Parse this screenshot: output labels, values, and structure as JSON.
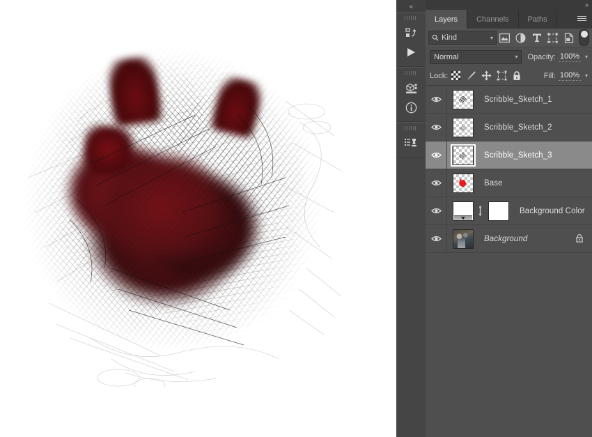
{
  "canvas": {
    "name": "artwork-canvas",
    "description": "Dark red scribbled creature silhouette with black pencil hatching on white background",
    "background_color": "#ffffff",
    "blob_color": "#520a0e",
    "scribble_color": "#1a1a1a"
  },
  "icon_rail": {
    "collapse_label": "«",
    "groups": [
      {
        "icons": [
          {
            "name": "history-icon",
            "glyph": "history"
          },
          {
            "name": "play-icon",
            "glyph": "play"
          }
        ]
      },
      {
        "icons": [
          {
            "name": "properties-3d-icon",
            "glyph": "cube"
          },
          {
            "name": "info-icon",
            "glyph": "info"
          }
        ]
      },
      {
        "icons": [
          {
            "name": "libraries-icon",
            "glyph": "stamp"
          }
        ]
      }
    ]
  },
  "panel": {
    "expand_label": "»",
    "menu_icon": "hamburger-icon",
    "tabs": [
      {
        "label": "Layers",
        "active": true
      },
      {
        "label": "Channels",
        "active": false
      },
      {
        "label": "Paths",
        "active": false
      }
    ],
    "filter": {
      "kind_label": "Kind",
      "search_icon": "search-icon",
      "icons": [
        {
          "name": "filter-pixel-icon",
          "glyph": "image"
        },
        {
          "name": "filter-adjustment-icon",
          "glyph": "half-circle"
        },
        {
          "name": "filter-type-icon",
          "glyph": "T"
        },
        {
          "name": "filter-shape-icon",
          "glyph": "shape"
        },
        {
          "name": "filter-smart-object-icon",
          "glyph": "smart"
        }
      ],
      "toggle_on": true
    },
    "blend_mode": "Normal",
    "opacity_label": "Opacity:",
    "opacity_value": "100%",
    "lock_label": "Lock:",
    "lock_icons": [
      {
        "name": "lock-transparency-icon",
        "glyph": "checker"
      },
      {
        "name": "lock-image-pixels-icon",
        "glyph": "brush"
      },
      {
        "name": "lock-position-icon",
        "glyph": "move"
      },
      {
        "name": "lock-artboard-icon",
        "glyph": "artboard"
      },
      {
        "name": "lock-all-icon",
        "glyph": "padlock"
      }
    ],
    "fill_label": "Fill:",
    "fill_value": "100%"
  },
  "layers": [
    {
      "name": "Scribble_Sketch_1",
      "visible": true,
      "selected": false,
      "thumb": "transparent-sketch",
      "locked": false,
      "italic": false,
      "has_mask": false
    },
    {
      "name": "Scribble_Sketch_2",
      "visible": true,
      "selected": false,
      "thumb": "transparent-sketch",
      "locked": false,
      "italic": false,
      "has_mask": false
    },
    {
      "name": "Scribble_Sketch_3",
      "visible": true,
      "selected": true,
      "thumb": "transparent-sketch",
      "locked": false,
      "italic": false,
      "has_mask": false
    },
    {
      "name": "Base",
      "visible": true,
      "selected": false,
      "thumb": "red-blob",
      "locked": false,
      "italic": false,
      "has_mask": false
    },
    {
      "name": "Background Color",
      "visible": true,
      "selected": false,
      "thumb": "solid-fill",
      "locked": false,
      "italic": false,
      "has_mask": true
    },
    {
      "name": "Background",
      "visible": true,
      "selected": false,
      "thumb": "photo",
      "locked": true,
      "italic": true,
      "has_mask": false
    }
  ]
}
